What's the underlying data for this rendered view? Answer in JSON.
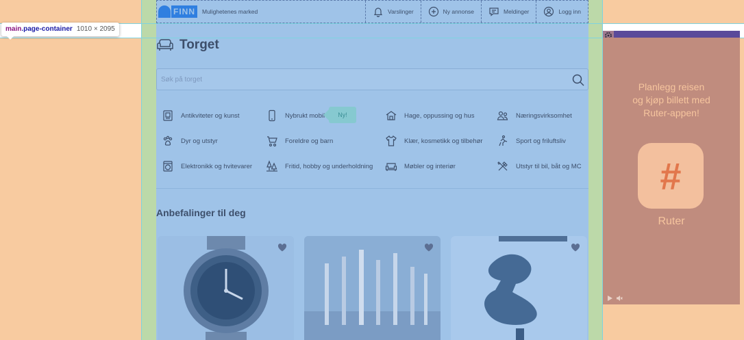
{
  "inspector": {
    "tag": "main",
    "class": ".page-container",
    "dimensions": "1010 × 2095"
  },
  "header": {
    "logo_text": "FINN",
    "tagline": "Mulighetenes marked",
    "nav": [
      {
        "label": "Varslinger",
        "icon": "bell-icon"
      },
      {
        "label": "Ny annonse",
        "icon": "plus-circle-icon"
      },
      {
        "label": "Meldinger",
        "icon": "message-icon"
      },
      {
        "label": "Logg inn",
        "icon": "user-circle-icon"
      }
    ]
  },
  "page": {
    "title": "Torget",
    "title_icon": "sofa-icon"
  },
  "search": {
    "placeholder": "Søk på torget"
  },
  "categories": [
    {
      "label": "Antikviteter og kunst",
      "icon": "frame-icon"
    },
    {
      "label": "Nybrukt mobil",
      "icon": "phone-icon",
      "badge": "Ny!"
    },
    {
      "label": "Hage, oppussing og hus",
      "icon": "house-icon"
    },
    {
      "label": "Næringsvirksomhet",
      "icon": "people-icon"
    },
    {
      "label": "Dyr og utstyr",
      "icon": "paw-icon"
    },
    {
      "label": "Foreldre og barn",
      "icon": "stroller-icon"
    },
    {
      "label": "Klær, kosmetikk og tilbehør",
      "icon": "shirt-icon"
    },
    {
      "label": "Sport og friluftsliv",
      "icon": "bike-icon"
    },
    {
      "label": "Elektronikk og hvitevarer",
      "icon": "washing-machine-icon"
    },
    {
      "label": "Fritid, hobby og underholdning",
      "icon": "trees-icon"
    },
    {
      "label": "Møbler og interiør",
      "icon": "sofa-icon"
    },
    {
      "label": "Utstyr til bil, båt og MC",
      "icon": "tools-icon"
    }
  ],
  "recommendations": {
    "title": "Anbefalinger til deg",
    "cards": [
      {
        "image": "watch-image"
      },
      {
        "image": "candlesticks-image"
      },
      {
        "image": "chair-image"
      }
    ]
  },
  "ad": {
    "headline": "Planlegg reisen\nog kjøp billett med\nRuter-appen!",
    "logo_symbol": "#",
    "brand": "Ruter"
  },
  "colors": {
    "overlay_blue": "#9fc3e8",
    "padding_green": "#bcd9a9",
    "margin_orange": "#f8cba0",
    "ad_background": "#c08c7e",
    "finn_blue": "#2f7fe0"
  }
}
